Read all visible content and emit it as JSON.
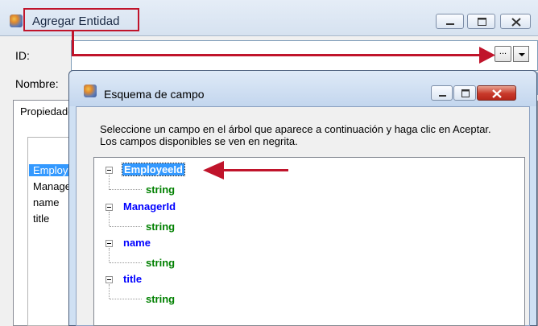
{
  "outer_window": {
    "title": "Agregar Entidad",
    "id_label": "ID:",
    "id_value": "",
    "ellipsis_label": "...",
    "nombre_label": "Nombre:",
    "nombre_value": "",
    "tab_label": "Propiedades",
    "property_list": [
      "EmployeeId",
      "ManagerId",
      "name",
      "title"
    ]
  },
  "dialog": {
    "title": "Esquema de campo",
    "description": "Seleccione un campo en el árbol que aparece a continuación y haga clic en Aceptar. Los campos disponibles se ven en negrita.",
    "tree": [
      {
        "name": "EmployeeId",
        "type": "string",
        "selected": true
      },
      {
        "name": "ManagerId",
        "type": "string"
      },
      {
        "name": "name",
        "type": "string"
      },
      {
        "name": "title",
        "type": "string"
      }
    ]
  },
  "colors": {
    "annotation_red": "#c0142b",
    "field_blue": "#0000ff",
    "type_green": "#008000",
    "selection_blue": "#3399ff"
  },
  "icons": [
    "app-icon",
    "minimize-icon",
    "maximize-icon",
    "close-icon",
    "dropdown-arrow-icon",
    "tree-collapse-icon",
    "red-arrow-annotation"
  ]
}
